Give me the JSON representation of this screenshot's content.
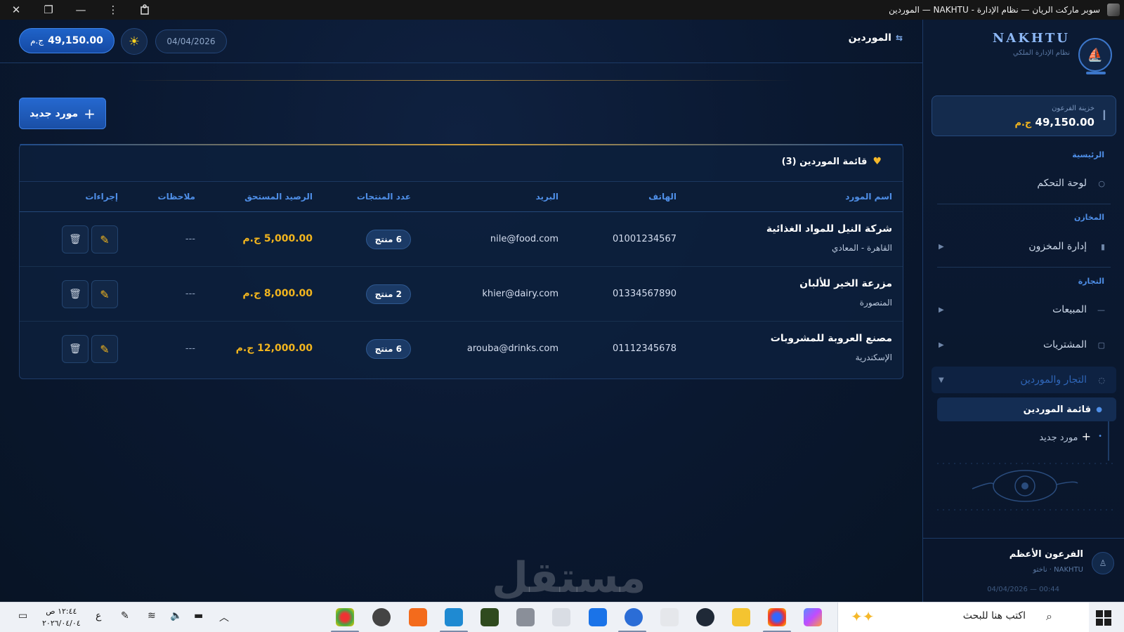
{
  "window": {
    "title": "سوبر ماركت الريان — نظام الإدارة - NAKHTU — الموردين",
    "close_glyph": "✕",
    "restore_glyph": "❐",
    "minimize_glyph": "—",
    "menu_glyph": "⋮"
  },
  "topbar": {
    "balance_value": "49,150.00",
    "balance_currency": "ج.م",
    "theme_icon": "sun-icon",
    "date": "04/04/2026",
    "page_title": "الموردين"
  },
  "toolbar": {
    "new_supplier_label": "مورد جديد"
  },
  "table": {
    "title": "قائمة الموردين (3)",
    "headers": [
      "اسم المورد",
      "الهاتف",
      "البريد",
      "عدد المنتجات",
      "الرصيد المستحق",
      "ملاحظات",
      "إجراءات"
    ],
    "rows": [
      {
        "name": "شركة النيل للمواد الغذائية",
        "city": "القاهرة - المعادي",
        "phone": "01001234567",
        "email": "nile@food.com",
        "products": "6 منتج",
        "balance": "5,000.00 ج.م",
        "notes": "---"
      },
      {
        "name": "مزرعة الخير للألبان",
        "city": "المنصورة",
        "phone": "01334567890",
        "email": "khier@dairy.com",
        "products": "2 منتج",
        "balance": "8,000.00 ج.م",
        "notes": "---"
      },
      {
        "name": "مصنع العروبة للمشروبات",
        "city": "الإسكندرية",
        "phone": "01112345678",
        "email": "arouba@drinks.com",
        "products": "6 منتج",
        "balance": "12,000.00 ج.م",
        "notes": "---"
      }
    ]
  },
  "sidebar": {
    "brand": "NAKHTU",
    "brand_sub": "نظام الإدارة الملكي",
    "treasury_label": "خزينة الفرعون",
    "treasury_value": "49,150.00",
    "treasury_currency": "ج.م",
    "sections": {
      "main": "الرئيسية",
      "stores": "المخازن",
      "trade": "التجارة"
    },
    "items": {
      "dashboard": "لوحة التحكم",
      "inventory": "إدارة المخزون",
      "sales": "المبيعات",
      "purchases": "المشتريات",
      "traders": "التجار والموردين",
      "suppliers_list": "قائمة الموردين",
      "new_supplier": "مورد جديد"
    },
    "user_name": "الفرعون الأعظم",
    "user_sub": "NAKHTU · ناختو",
    "footer": "04/04/2026 — 00:44"
  },
  "watermark": "مستقل",
  "taskbar": {
    "search_placeholder": "اكتب هنا للبحث",
    "clock_time": "١٢:٤٤ ص",
    "clock_date": "٢٠٢٦/٠٤/٠٤",
    "lang": "ع"
  },
  "colors": {
    "accent": "#2568cf",
    "gold": "#f2b51e",
    "bg": "#0a1628"
  }
}
